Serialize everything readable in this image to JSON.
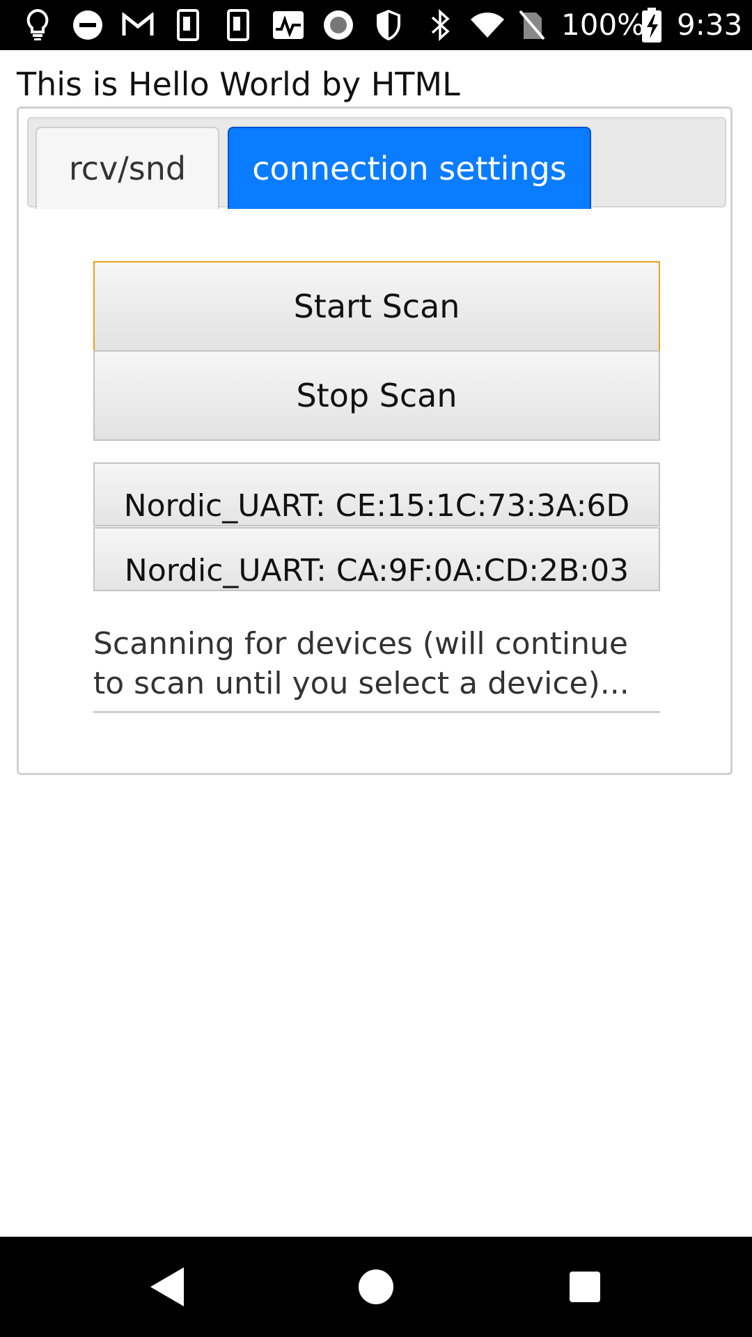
{
  "status_bar": {
    "icons": [
      "lightbulb-icon",
      "do-not-disturb-icon",
      "gmail-icon",
      "sim-card-icon",
      "sim-card-icon",
      "activity-icon",
      "record-icon",
      "shield-icon",
      "bluetooth-icon",
      "wifi-icon",
      "no-sim-icon",
      "battery-charging-icon"
    ],
    "battery": "100%",
    "time": "9:33"
  },
  "page": {
    "title": "This is Hello World by HTML"
  },
  "tabs": [
    {
      "label": "rcv/snd",
      "active": false
    },
    {
      "label": "connection settings",
      "active": true
    }
  ],
  "controls": {
    "start_scan": "Start Scan",
    "stop_scan": "Stop Scan"
  },
  "devices": [
    {
      "label": "Nordic_UART: CE:15:1C:73:3A:6D"
    },
    {
      "label": "Nordic_UART: CA:9F:0A:CD:2B:03"
    }
  ],
  "scan_status": "Scanning for devices (will continue to scan until you select a device)...",
  "colors": {
    "active_tab": "#0a7cff",
    "focus_border": "#e8a21a"
  },
  "nav_bar": [
    "back-icon",
    "home-icon",
    "recents-icon"
  ]
}
